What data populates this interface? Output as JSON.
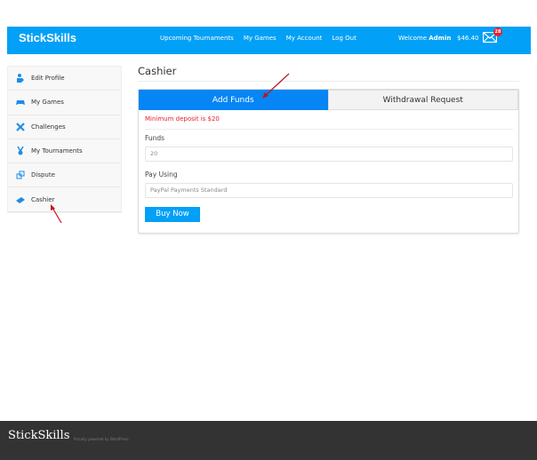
{
  "header": {
    "logo": "StickSkills",
    "nav": [
      "Upcoming Tournaments",
      "My Games",
      "My Account",
      "Log Out"
    ],
    "welcome_prefix": "Welcome ",
    "user": "Admin",
    "balance": "$46.40",
    "mail_badge": "28",
    "color": "#02a0f6"
  },
  "sidebar": {
    "items": [
      {
        "label": "Edit Profile",
        "icon": "user-edit-icon"
      },
      {
        "label": "My Games",
        "icon": "gamepad-icon"
      },
      {
        "label": "Challenges",
        "icon": "crossed-swords-icon"
      },
      {
        "label": "My Tournaments",
        "icon": "medal-icon"
      },
      {
        "label": "Dispute",
        "icon": "dispute-icon"
      },
      {
        "label": "Cashier",
        "icon": "money-icon"
      }
    ]
  },
  "main": {
    "title": "Cashier",
    "tabs": [
      {
        "label": "Add Funds",
        "active": true
      },
      {
        "label": "Withdrawal Request",
        "active": false
      }
    ],
    "error": "Minimum deposit is $20",
    "funds_label": "Funds",
    "funds_value": "20",
    "pay_label": "Pay Using",
    "pay_value": "PayPal Payments Standard",
    "submit": "Buy Now"
  },
  "footer": {
    "logo": "StickSkills",
    "tagline": "Proudly powered by WordPress"
  }
}
